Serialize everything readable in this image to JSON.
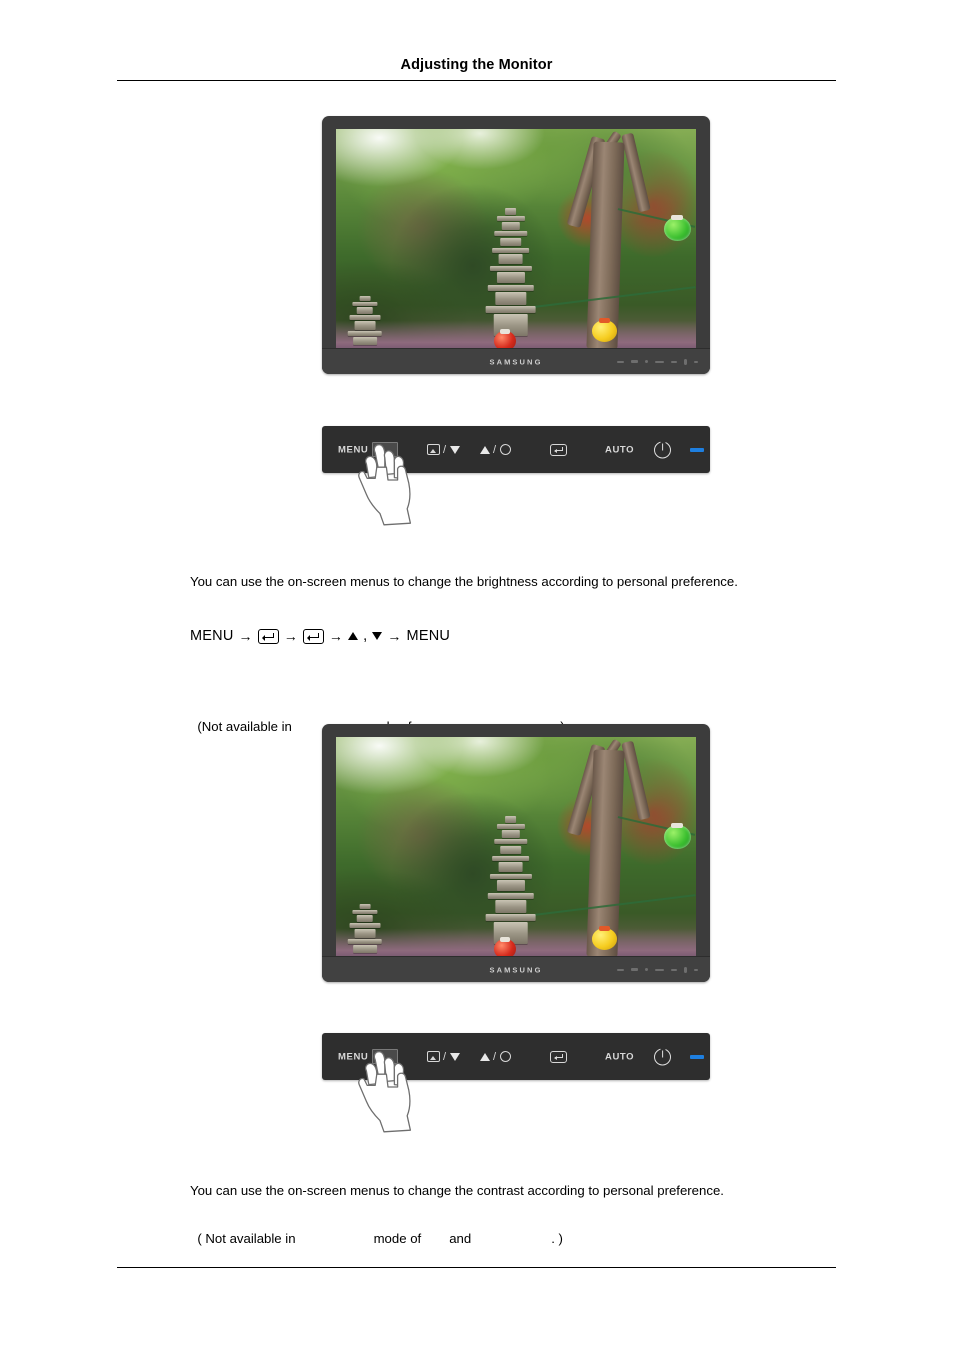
{
  "document": {
    "header_title": "Adjusting the Monitor"
  },
  "brand": {
    "logo_text": "SAMSUNG"
  },
  "control_panel": {
    "menu_label": "MENU",
    "source_down_label": "",
    "up_enter_label": "",
    "enter_label": "",
    "auto_label": "AUTO",
    "power_label": "",
    "led_label": "",
    "slash": "/",
    "comma": ","
  },
  "sections": [
    {
      "id": "brightness",
      "paragraph": "You can use the on-screen menus to change the brightness according to personal preference.",
      "nav": {
        "start_label": "MENU",
        "end_label": "MENU",
        "arrow": "→",
        "separator": ","
      },
      "note": {
        "prefix": "(Not available in",
        "middle": "mode of",
        "suffix": ".)"
      }
    },
    {
      "id": "contrast",
      "paragraph": "You can use the on-screen menus to change the contrast according to personal preference.",
      "note": {
        "prefix": "( Not available in",
        "middle": "mode of",
        "conjunction": "and",
        "suffix": ". )"
      }
    }
  ],
  "colors": {
    "bezel": "#3c3c3c",
    "panel": "#2e2e2e",
    "led_blue": "#1e7fe0",
    "text": "#000000"
  }
}
